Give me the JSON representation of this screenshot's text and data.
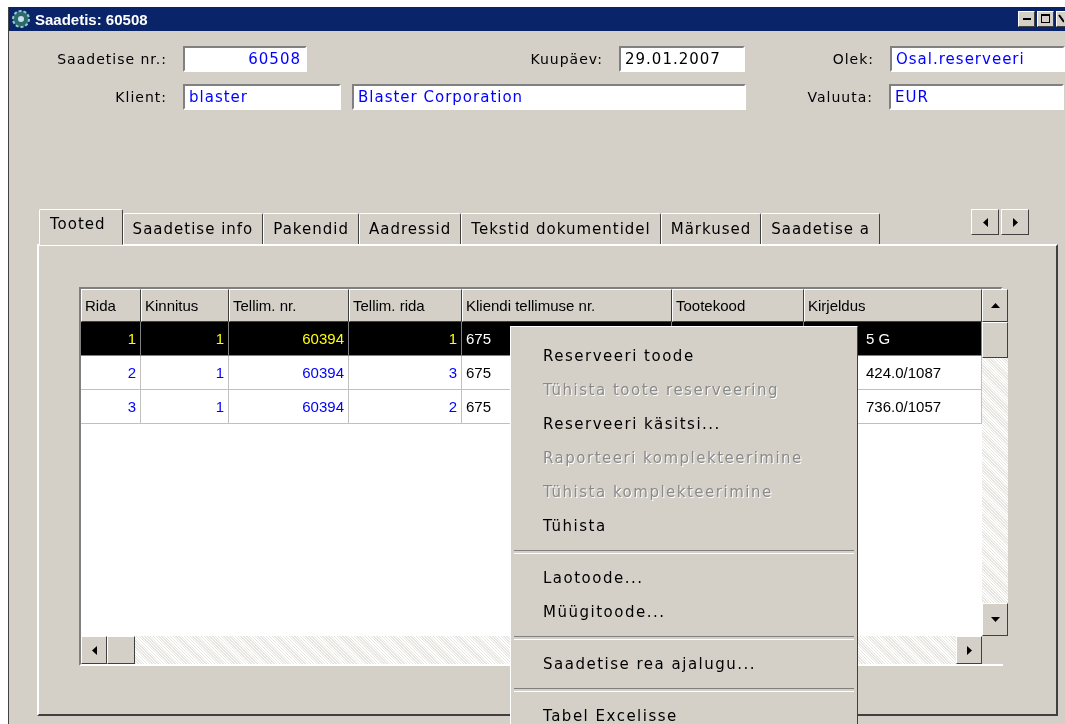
{
  "window": {
    "title": "Saadetis: 60508"
  },
  "header": {
    "saadetise_nr_label": "Saadetise nr.:",
    "saadetise_nr": "60508",
    "kuupaev_label": "Kuupäev:",
    "kuupaev": "29.01.2007",
    "olek_label": "Olek:",
    "olek": "Osal.reserveeri",
    "klient_label": "Klient:",
    "klient_kood": "blaster",
    "klient_nimi": "Blaster Corporation",
    "valuuta_label": "Valuuta:",
    "valuuta": "EUR"
  },
  "tabs": [
    {
      "label": "Tooted",
      "selected": true
    },
    {
      "label": "Saadetise info",
      "selected": false
    },
    {
      "label": "Pakendid",
      "selected": false
    },
    {
      "label": "Aadressid",
      "selected": false
    },
    {
      "label": "Tekstid dokumentidel",
      "selected": false
    },
    {
      "label": "Märkused",
      "selected": false
    },
    {
      "label": "Saadetise a",
      "selected": false
    }
  ],
  "table": {
    "columns": [
      "Rida",
      "Kinnitus",
      "Tellim. nr.",
      "Tellim. rida",
      "Kliendi tellimuse nr.",
      "Tootekood",
      "Kirjeldus"
    ],
    "rows": [
      {
        "selected": true,
        "rida": "1",
        "kinnitus": "1",
        "tellim_nr": "60394",
        "tellim_rida": "1",
        "kliendi_tellimuse_nr": "675",
        "kirjeldus": "5 G"
      },
      {
        "selected": false,
        "rida": "2",
        "kinnitus": "1",
        "tellim_nr": "60394",
        "tellim_rida": "3",
        "kliendi_tellimuse_nr": "675",
        "kirjeldus": "424.0/1087"
      },
      {
        "selected": false,
        "rida": "3",
        "kinnitus": "1",
        "tellim_nr": "60394",
        "tellim_rida": "2",
        "kliendi_tellimuse_nr": "675",
        "kirjeldus": "736.0/1057"
      }
    ]
  },
  "context_menu": [
    {
      "kind": "item",
      "label": "Reserveeri toode",
      "disabled": false
    },
    {
      "kind": "item",
      "label": "Tühista toote reserveering",
      "disabled": true
    },
    {
      "kind": "item",
      "label": "Reserveeri käsitsi...",
      "disabled": false
    },
    {
      "kind": "item",
      "label": "Raporteeri komplekteerimine",
      "disabled": true
    },
    {
      "kind": "item",
      "label": "Tühista komplekteerimine",
      "disabled": true
    },
    {
      "kind": "item",
      "label": "Tühista",
      "disabled": false
    },
    {
      "kind": "separator"
    },
    {
      "kind": "item",
      "label": "Laotoode...",
      "disabled": false
    },
    {
      "kind": "item",
      "label": "Müügitoode...",
      "disabled": false
    },
    {
      "kind": "separator"
    },
    {
      "kind": "item",
      "label": "Saadetise rea ajalugu...",
      "disabled": false
    },
    {
      "kind": "separator"
    },
    {
      "kind": "item",
      "label": "Tabel Excelisse",
      "disabled": false
    }
  ]
}
